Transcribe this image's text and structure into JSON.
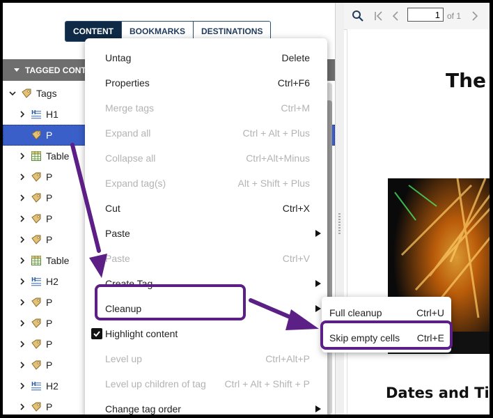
{
  "tabs": [
    {
      "label": "CONTENT",
      "active": true
    },
    {
      "label": "BOOKMARKS",
      "active": false
    },
    {
      "label": "DESTINATIONS",
      "active": false
    }
  ],
  "tagged_content": {
    "header": "TAGGED CONTENT",
    "root_label": "Tags",
    "rows": [
      {
        "label": "H1",
        "icon": "heading-tag-icon",
        "expandable": true
      },
      {
        "label": "P",
        "icon": "tag-icon",
        "expandable": false,
        "selected": true
      },
      {
        "label": "Table",
        "icon": "table-tag-icon",
        "expandable": true
      },
      {
        "label": "P",
        "icon": "tag-icon",
        "expandable": true
      },
      {
        "label": "P",
        "icon": "tag-icon",
        "expandable": true
      },
      {
        "label": "P",
        "icon": "tag-icon",
        "expandable": true
      },
      {
        "label": "P",
        "icon": "tag-icon",
        "expandable": true
      },
      {
        "label": "Table",
        "icon": "table-tag-icon",
        "expandable": true
      },
      {
        "label": "H2",
        "icon": "heading-tag-icon",
        "expandable": true
      },
      {
        "label": "P",
        "icon": "tag-icon",
        "expandable": true
      },
      {
        "label": "P",
        "icon": "tag-icon",
        "expandable": true
      },
      {
        "label": "P",
        "icon": "tag-icon",
        "expandable": true
      },
      {
        "label": "P",
        "icon": "tag-icon",
        "expandable": true
      },
      {
        "label": "H2",
        "icon": "heading-tag-icon",
        "expandable": true
      },
      {
        "label": "P",
        "icon": "tag-icon",
        "expandable": true
      }
    ]
  },
  "context_menu": {
    "items": [
      {
        "label": "Untag",
        "shortcut": "Delete",
        "disabled": false
      },
      {
        "label": "Properties",
        "shortcut": "Ctrl+F6",
        "disabled": false
      },
      {
        "label": "Merge tags",
        "shortcut": "Ctrl+M",
        "disabled": true
      },
      {
        "label": "Expand all",
        "shortcut": "Ctrl + Alt + Plus",
        "disabled": true
      },
      {
        "label": "Collapse all",
        "shortcut": "Ctrl+Alt+Minus",
        "disabled": true
      },
      {
        "label": "Expand tag(s)",
        "shortcut": "Alt + Shift + Plus",
        "disabled": true
      },
      {
        "label": "Cut",
        "shortcut": "Ctrl+X",
        "disabled": false
      },
      {
        "label": "Paste",
        "shortcut": "",
        "disabled": false,
        "submenu": true
      },
      {
        "label": "Paste",
        "shortcut": "Ctrl+V",
        "disabled": true
      },
      {
        "label": "Create Tag",
        "shortcut": "",
        "disabled": false,
        "submenu": true
      },
      {
        "label": "Cleanup",
        "shortcut": "",
        "disabled": false,
        "submenu": true
      },
      {
        "label": "Highlight content",
        "shortcut": "",
        "disabled": false,
        "checkbox": true,
        "checked": true
      },
      {
        "label": "Level up",
        "shortcut": "Ctrl+Alt+P",
        "disabled": true
      },
      {
        "label": "Level up children of tag",
        "shortcut": "Ctrl + Alt + Shift + P",
        "disabled": true
      },
      {
        "label": "Change tag order",
        "shortcut": "",
        "disabled": false,
        "submenu": true
      }
    ]
  },
  "cleanup_submenu": {
    "items": [
      {
        "label": "Full cleanup",
        "shortcut": "Ctrl+U"
      },
      {
        "label": "Skip empty cells",
        "shortcut": "Ctrl+E"
      }
    ]
  },
  "document": {
    "page_value": "1",
    "page_of": "of 1",
    "title": "The A",
    "subheading": "Dates and Tick"
  },
  "colors": {
    "tab_active": "#0e2a47",
    "selection": "#3b5fc9",
    "annotation": "#5b1f86",
    "header_bar": "#6e6e6e"
  }
}
